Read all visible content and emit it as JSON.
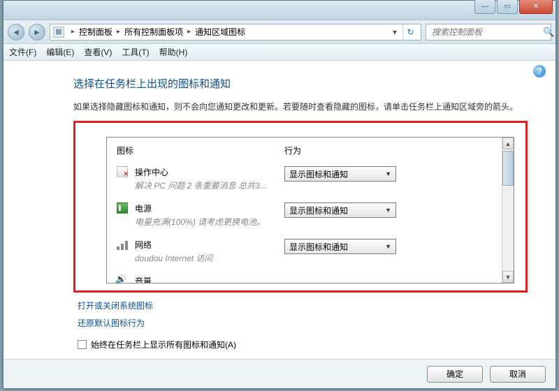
{
  "titlebar": {
    "min": "—",
    "max": "▭",
    "close": "✕"
  },
  "breadcrumb": {
    "root_icon": "▦",
    "items": [
      "控制面板",
      "所有控制面板项",
      "通知区域图标"
    ]
  },
  "search": {
    "placeholder": "搜索控制面板"
  },
  "menu": {
    "file": "文件(F)",
    "edit": "编辑(E)",
    "view": "查看(V)",
    "tools": "工具(T)",
    "help": "帮助(H)"
  },
  "page": {
    "heading": "选择在任务栏上出现的图标和通知",
    "description": "如果选择隐藏图标和通知，则不会向您通知更改和更新。若要随时查看隐藏的图标，请单击任务栏上通知区域旁的箭头。",
    "col_icon": "图标",
    "col_action": "行为",
    "link_sysicons": "打开或关闭系统图标",
    "link_restore": "还原默认图标行为",
    "checkbox_label": "始终在任务栏上显示所有图标和通知(A)"
  },
  "rows": [
    {
      "title": "操作中心",
      "sub": "解决 PC 问题  2 条重要消息  总共3...",
      "combo": "显示图标和通知"
    },
    {
      "title": "电源",
      "sub": "电量充满(100%) 请考虑更换电池。",
      "combo": "显示图标和通知"
    },
    {
      "title": "网络",
      "sub": "doudou Internet 访问",
      "combo": "显示图标和通知"
    },
    {
      "title": "音量",
      "sub": "",
      "combo": ""
    }
  ],
  "footer": {
    "ok": "确定",
    "cancel": "取消"
  }
}
